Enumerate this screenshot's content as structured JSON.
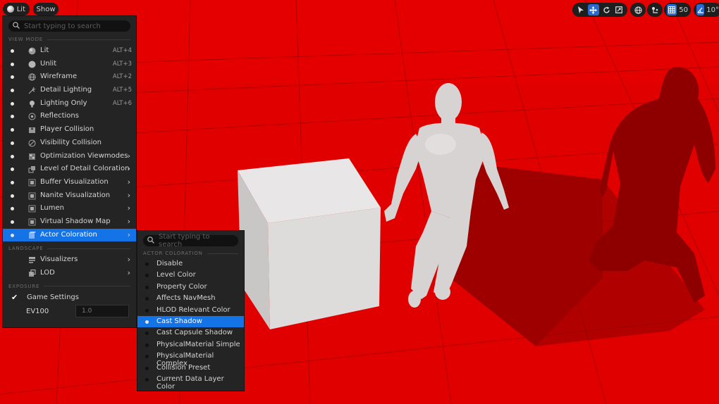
{
  "toolbar": {
    "view_mode_label": "Lit",
    "show_label": "Show",
    "grid_snap_value": "50",
    "rotation_snap_value": "10°"
  },
  "main_menu": {
    "search_placeholder": "Start typing to search",
    "sections": {
      "view_mode": "VIEW MODE",
      "landscape": "LANDSCAPE",
      "exposure": "EXPOSURE"
    },
    "view_modes": [
      {
        "label": "Lit",
        "shortcut": "ALT+4",
        "icon": "lit-sphere-icon",
        "submenu": false,
        "selected": false
      },
      {
        "label": "Unlit",
        "shortcut": "ALT+3",
        "icon": "unlit-sphere-icon",
        "submenu": false,
        "selected": false
      },
      {
        "label": "Wireframe",
        "shortcut": "ALT+2",
        "icon": "wireframe-sphere-icon",
        "submenu": false,
        "selected": false
      },
      {
        "label": "Detail Lighting",
        "shortcut": "ALT+5",
        "icon": "detail-lighting-icon",
        "submenu": false,
        "selected": false
      },
      {
        "label": "Lighting Only",
        "shortcut": "ALT+6",
        "icon": "lightbulb-icon",
        "submenu": false,
        "selected": false
      },
      {
        "label": "Reflections",
        "shortcut": "",
        "icon": "reflections-icon",
        "submenu": false,
        "selected": false
      },
      {
        "label": "Player Collision",
        "shortcut": "",
        "icon": "player-collision-icon",
        "submenu": false,
        "selected": false
      },
      {
        "label": "Visibility Collision",
        "shortcut": "",
        "icon": "visibility-collision-icon",
        "submenu": false,
        "selected": false
      },
      {
        "label": "Optimization Viewmodes",
        "shortcut": "",
        "icon": "optimization-icon",
        "submenu": true,
        "selected": false
      },
      {
        "label": "Level of Detail Coloration",
        "shortcut": "",
        "icon": "lod-coloration-icon",
        "submenu": true,
        "selected": false
      },
      {
        "label": "Buffer Visualization",
        "shortcut": "",
        "icon": "buffer-icon",
        "submenu": true,
        "selected": false
      },
      {
        "label": "Nanite Visualization",
        "shortcut": "",
        "icon": "nanite-icon",
        "submenu": true,
        "selected": false
      },
      {
        "label": "Lumen",
        "shortcut": "",
        "icon": "lumen-icon",
        "submenu": true,
        "selected": false
      },
      {
        "label": "Virtual Shadow Map",
        "shortcut": "",
        "icon": "shadow-map-icon",
        "submenu": true,
        "selected": false
      },
      {
        "label": "Actor Coloration",
        "shortcut": "",
        "icon": "actor-coloration-icon",
        "submenu": true,
        "selected": true
      }
    ],
    "landscape_items": [
      {
        "label": "Visualizers",
        "icon": "visualizers-icon"
      },
      {
        "label": "LOD",
        "icon": "lod-icon"
      }
    ],
    "exposure": {
      "game_settings_label": "Game Settings",
      "game_settings_checked": true,
      "ev100_label": "EV100",
      "ev100_value": "1.0"
    }
  },
  "sub_menu": {
    "search_placeholder": "Start typing to search",
    "section": "ACTOR COLORATION",
    "items": [
      {
        "label": "Disable",
        "selected": false
      },
      {
        "label": "Level Color",
        "selected": false
      },
      {
        "label": "Property Color",
        "selected": false
      },
      {
        "label": "Affects NavMesh",
        "selected": false
      },
      {
        "label": "HLOD Relevant Color",
        "selected": false
      },
      {
        "label": "Cast Shadow",
        "selected": true
      },
      {
        "label": "Cast Capsule Shadow",
        "selected": false
      },
      {
        "label": "PhysicalMaterial Simple",
        "selected": false
      },
      {
        "label": "PhysicalMaterial Complex",
        "selected": false
      },
      {
        "label": "Collision Preset",
        "selected": false
      },
      {
        "label": "Current Data Layer Color",
        "selected": false
      }
    ]
  },
  "colors": {
    "scene_red": "#e00000",
    "selection_blue": "#1473e6",
    "menu_bg": "#242424"
  }
}
